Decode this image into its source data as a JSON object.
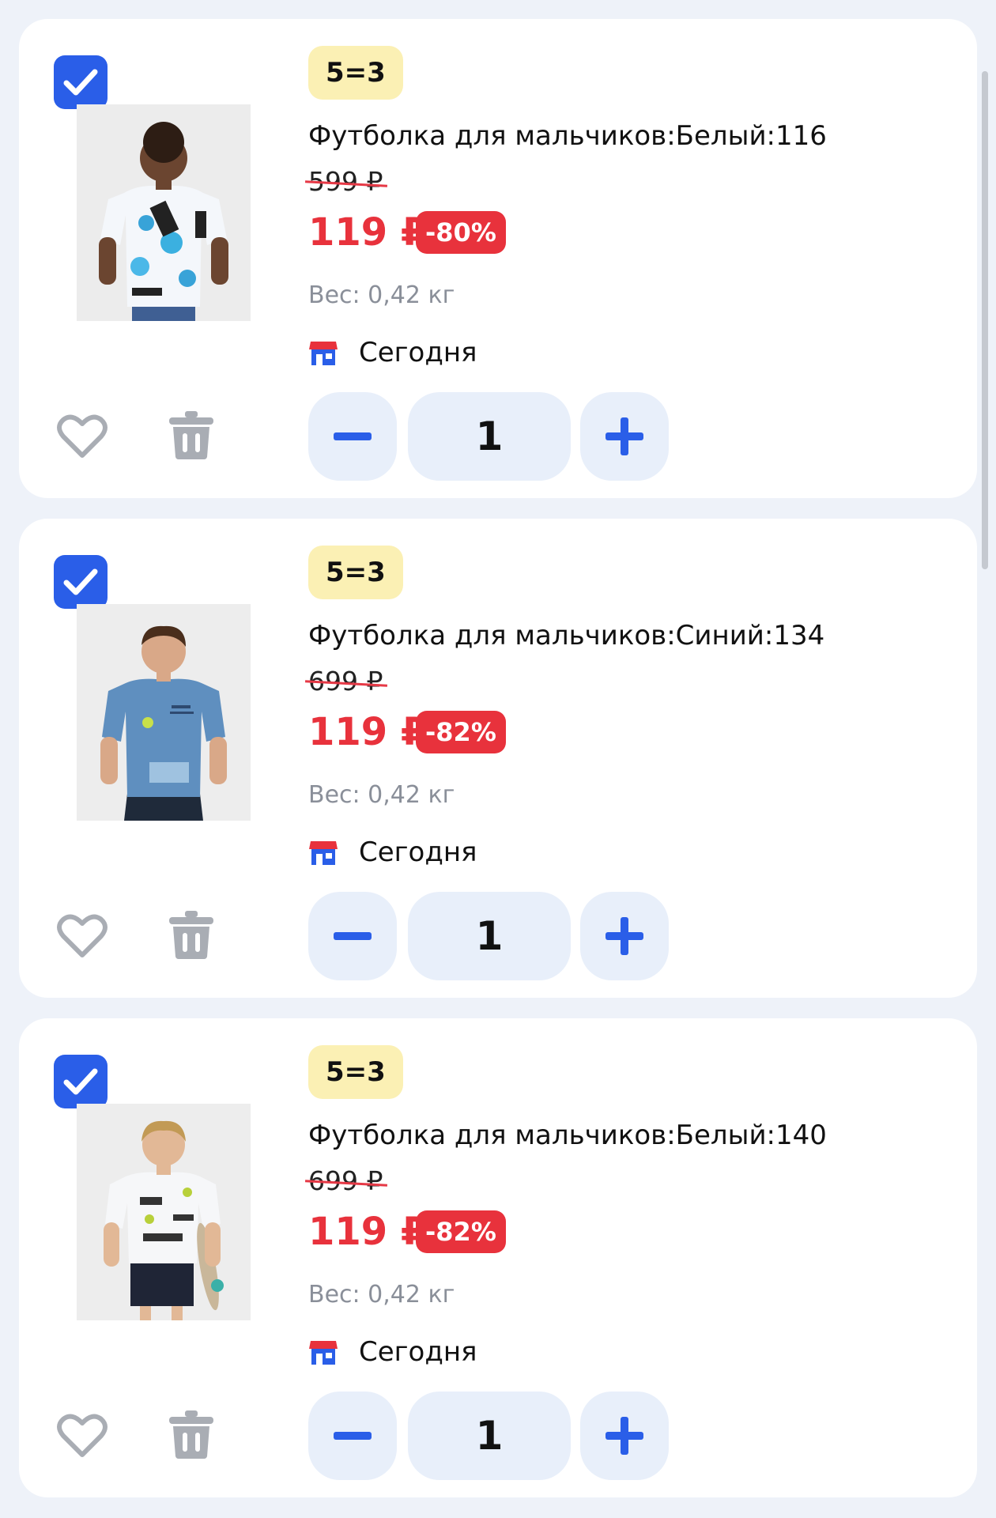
{
  "cart": {
    "items": [
      {
        "promo": "5=3",
        "title": "Футболка для мальчиков:Белый:116",
        "old_price": "599 ₽",
        "price": "119 ₽",
        "discount": "-80%",
        "weight": "Вес: 0,42 кг",
        "delivery": "Сегодня",
        "quantity": "1",
        "checked": true,
        "image": "boy-white-graffiti-tshirt"
      },
      {
        "promo": "5=3",
        "title": "Футболка для мальчиков:Синий:134",
        "old_price": "699 ₽",
        "price": "119 ₽",
        "discount": "-82%",
        "weight": "Вес: 0,42 кг",
        "delivery": "Сегодня",
        "quantity": "1",
        "checked": true,
        "image": "boy-blue-tshirt"
      },
      {
        "promo": "5=3",
        "title": "Футболка для мальчиков:Белый:140",
        "old_price": "699 ₽",
        "price": "119 ₽",
        "discount": "-82%",
        "weight": "Вес: 0,42 кг",
        "delivery": "Сегодня",
        "quantity": "1",
        "checked": true,
        "image": "boy-white-print-tshirt-skateboard"
      }
    ]
  },
  "icons": {
    "checkbox": "checkmark-icon",
    "delivery": "store-icon",
    "favorite": "heart-icon",
    "remove": "trash-icon",
    "decrease": "minus-icon",
    "increase": "plus-icon"
  },
  "colors": {
    "accent": "#2a5ee8",
    "price": "#e8323c",
    "promo_bg": "#fbf0b4",
    "stepper_bg": "#e8effa",
    "page_bg": "#eef2f9"
  }
}
